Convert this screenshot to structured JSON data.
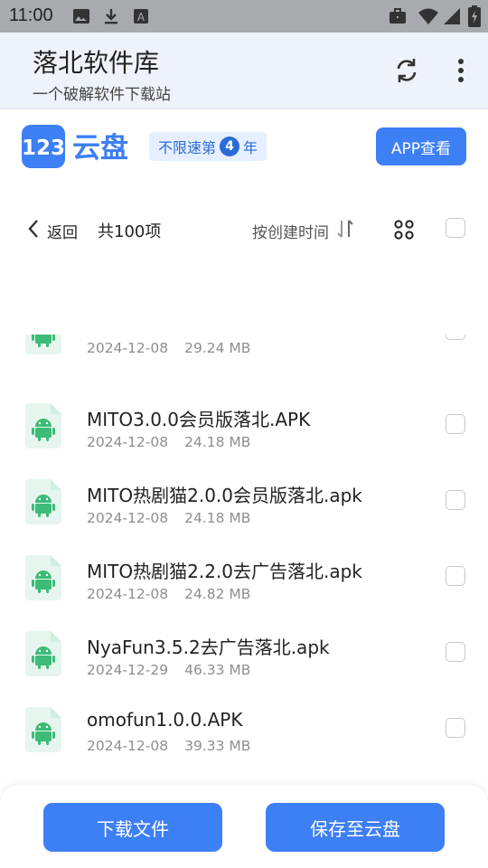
{
  "status_bar": {
    "time": "11:00",
    "icons": [
      "image-icon",
      "download-icon",
      "a-box-icon",
      "briefcase-icon",
      "wifi-icon",
      "signal-icon",
      "battery-icon"
    ]
  },
  "app_bar": {
    "title": "落北软件库",
    "subtitle": "一个破解软件下载站",
    "icons": [
      "refresh-icon",
      "more-vertical-icon"
    ]
  },
  "cloud_header": {
    "logo_number": "123",
    "logo_text": "云盘",
    "badge_prefix": "不限速第",
    "badge_number": "4",
    "badge_suffix": "年",
    "app_button": "APP查看",
    "brand_color": "#3d7ff5"
  },
  "toolbar": {
    "back_label": "返回",
    "count_label": "共100项",
    "sort_label": "按创建时间"
  },
  "files": [
    {
      "name": "",
      "date": "2024-12-08",
      "size": "29.24 MB"
    },
    {
      "name": "MITO3.0.0会员版落北.APK",
      "date": "2024-12-08",
      "size": "24.18 MB"
    },
    {
      "name": "MITO热剧猫2.0.0会员版落北.apk",
      "date": "2024-12-08",
      "size": "24.18 MB"
    },
    {
      "name": "MITO热剧猫2.2.0去广告落北.apk",
      "date": "2024-12-08",
      "size": "24.82 MB"
    },
    {
      "name": "NyaFun3.5.2去广告落北.apk",
      "date": "2024-12-29",
      "size": "46.33 MB"
    },
    {
      "name": "omofun1.0.0.APK",
      "date": "2024-12-08",
      "size": "39.33 MB"
    }
  ],
  "bottom": {
    "download_label": "下载文件",
    "save_label": "保存至云盘"
  }
}
